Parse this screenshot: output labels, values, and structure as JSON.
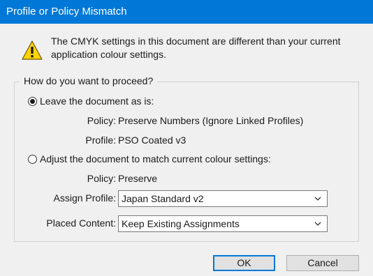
{
  "window": {
    "title": "Profile or Policy Mismatch"
  },
  "message": {
    "text": "The CMYK settings in this document are different than your current application colour settings."
  },
  "group": {
    "legend": "How do you want to proceed?"
  },
  "option_leave": {
    "label": "Leave the document as is:",
    "selected": true,
    "policy_label": "Policy:",
    "policy_value": "Preserve Numbers (Ignore Linked Profiles)",
    "profile_label": "Profile:",
    "profile_value": "PSO Coated v3"
  },
  "option_adjust": {
    "label": "Adjust the document to match current colour settings:",
    "selected": false,
    "policy_label": "Policy:",
    "policy_value": "Preserve",
    "assign_profile_label": "Assign Profile:",
    "assign_profile_value": "Japan Standard v2",
    "placed_content_label": "Placed Content:",
    "placed_content_value": "Keep Existing Assignments"
  },
  "buttons": {
    "ok": "OK",
    "cancel": "Cancel"
  },
  "colors": {
    "titlebar": "#0078d7",
    "warning": "#ffd400",
    "dialog_bg": "#f0f0f0"
  }
}
